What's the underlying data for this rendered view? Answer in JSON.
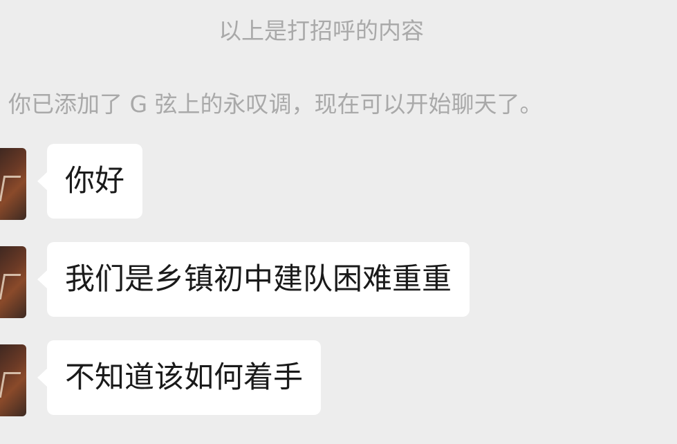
{
  "system_messages": {
    "greeting_note": "以上是打招呼的内容",
    "added_note": "你已添加了 G 弦上的永叹调，现在可以开始聊天了。"
  },
  "messages": [
    {
      "text": "你好"
    },
    {
      "text": "我们是乡镇初中建队困难重重"
    },
    {
      "text": "不知道该如何着手"
    }
  ]
}
